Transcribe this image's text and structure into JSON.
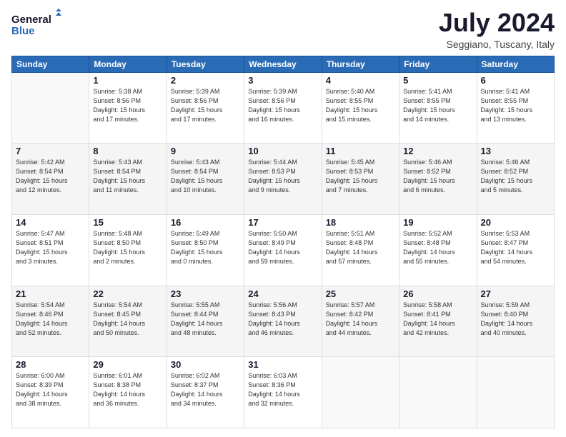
{
  "header": {
    "logo_line1": "General",
    "logo_line2": "Blue",
    "month": "July 2024",
    "location": "Seggiano, Tuscany, Italy"
  },
  "weekdays": [
    "Sunday",
    "Monday",
    "Tuesday",
    "Wednesday",
    "Thursday",
    "Friday",
    "Saturday"
  ],
  "weeks": [
    [
      {
        "num": "",
        "info": ""
      },
      {
        "num": "1",
        "info": "Sunrise: 5:38 AM\nSunset: 8:56 PM\nDaylight: 15 hours\nand 17 minutes."
      },
      {
        "num": "2",
        "info": "Sunrise: 5:39 AM\nSunset: 8:56 PM\nDaylight: 15 hours\nand 17 minutes."
      },
      {
        "num": "3",
        "info": "Sunrise: 5:39 AM\nSunset: 8:56 PM\nDaylight: 15 hours\nand 16 minutes."
      },
      {
        "num": "4",
        "info": "Sunrise: 5:40 AM\nSunset: 8:55 PM\nDaylight: 15 hours\nand 15 minutes."
      },
      {
        "num": "5",
        "info": "Sunrise: 5:41 AM\nSunset: 8:55 PM\nDaylight: 15 hours\nand 14 minutes."
      },
      {
        "num": "6",
        "info": "Sunrise: 5:41 AM\nSunset: 8:55 PM\nDaylight: 15 hours\nand 13 minutes."
      }
    ],
    [
      {
        "num": "7",
        "info": "Sunrise: 5:42 AM\nSunset: 8:54 PM\nDaylight: 15 hours\nand 12 minutes."
      },
      {
        "num": "8",
        "info": "Sunrise: 5:43 AM\nSunset: 8:54 PM\nDaylight: 15 hours\nand 11 minutes."
      },
      {
        "num": "9",
        "info": "Sunrise: 5:43 AM\nSunset: 8:54 PM\nDaylight: 15 hours\nand 10 minutes."
      },
      {
        "num": "10",
        "info": "Sunrise: 5:44 AM\nSunset: 8:53 PM\nDaylight: 15 hours\nand 9 minutes."
      },
      {
        "num": "11",
        "info": "Sunrise: 5:45 AM\nSunset: 8:53 PM\nDaylight: 15 hours\nand 7 minutes."
      },
      {
        "num": "12",
        "info": "Sunrise: 5:46 AM\nSunset: 8:52 PM\nDaylight: 15 hours\nand 6 minutes."
      },
      {
        "num": "13",
        "info": "Sunrise: 5:46 AM\nSunset: 8:52 PM\nDaylight: 15 hours\nand 5 minutes."
      }
    ],
    [
      {
        "num": "14",
        "info": "Sunrise: 5:47 AM\nSunset: 8:51 PM\nDaylight: 15 hours\nand 3 minutes."
      },
      {
        "num": "15",
        "info": "Sunrise: 5:48 AM\nSunset: 8:50 PM\nDaylight: 15 hours\nand 2 minutes."
      },
      {
        "num": "16",
        "info": "Sunrise: 5:49 AM\nSunset: 8:50 PM\nDaylight: 15 hours\nand 0 minutes."
      },
      {
        "num": "17",
        "info": "Sunrise: 5:50 AM\nSunset: 8:49 PM\nDaylight: 14 hours\nand 59 minutes."
      },
      {
        "num": "18",
        "info": "Sunrise: 5:51 AM\nSunset: 8:48 PM\nDaylight: 14 hours\nand 57 minutes."
      },
      {
        "num": "19",
        "info": "Sunrise: 5:52 AM\nSunset: 8:48 PM\nDaylight: 14 hours\nand 55 minutes."
      },
      {
        "num": "20",
        "info": "Sunrise: 5:53 AM\nSunset: 8:47 PM\nDaylight: 14 hours\nand 54 minutes."
      }
    ],
    [
      {
        "num": "21",
        "info": "Sunrise: 5:54 AM\nSunset: 8:46 PM\nDaylight: 14 hours\nand 52 minutes."
      },
      {
        "num": "22",
        "info": "Sunrise: 5:54 AM\nSunset: 8:45 PM\nDaylight: 14 hours\nand 50 minutes."
      },
      {
        "num": "23",
        "info": "Sunrise: 5:55 AM\nSunset: 8:44 PM\nDaylight: 14 hours\nand 48 minutes."
      },
      {
        "num": "24",
        "info": "Sunrise: 5:56 AM\nSunset: 8:43 PM\nDaylight: 14 hours\nand 46 minutes."
      },
      {
        "num": "25",
        "info": "Sunrise: 5:57 AM\nSunset: 8:42 PM\nDaylight: 14 hours\nand 44 minutes."
      },
      {
        "num": "26",
        "info": "Sunrise: 5:58 AM\nSunset: 8:41 PM\nDaylight: 14 hours\nand 42 minutes."
      },
      {
        "num": "27",
        "info": "Sunrise: 5:59 AM\nSunset: 8:40 PM\nDaylight: 14 hours\nand 40 minutes."
      }
    ],
    [
      {
        "num": "28",
        "info": "Sunrise: 6:00 AM\nSunset: 8:39 PM\nDaylight: 14 hours\nand 38 minutes."
      },
      {
        "num": "29",
        "info": "Sunrise: 6:01 AM\nSunset: 8:38 PM\nDaylight: 14 hours\nand 36 minutes."
      },
      {
        "num": "30",
        "info": "Sunrise: 6:02 AM\nSunset: 8:37 PM\nDaylight: 14 hours\nand 34 minutes."
      },
      {
        "num": "31",
        "info": "Sunrise: 6:03 AM\nSunset: 8:36 PM\nDaylight: 14 hours\nand 32 minutes."
      },
      {
        "num": "",
        "info": ""
      },
      {
        "num": "",
        "info": ""
      },
      {
        "num": "",
        "info": ""
      }
    ]
  ]
}
